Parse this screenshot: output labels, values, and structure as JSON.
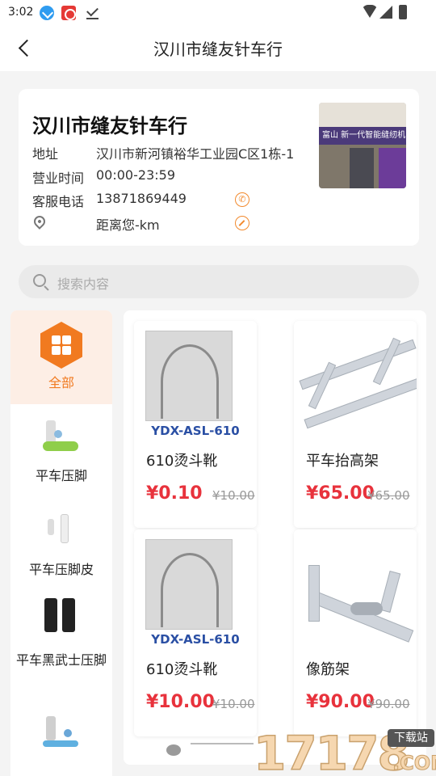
{
  "status_bar": {
    "time": "3:02"
  },
  "nav": {
    "title": "汉川市缝友针车行"
  },
  "shop": {
    "name": "汉川市缝友针车行",
    "address_label": "地址",
    "address": "汉川市新河镇裕华工业园C区1栋-1",
    "hours_label": "营业时间",
    "hours": "00:00-23:59",
    "phone_label": "客服电话",
    "phone": "13871869449",
    "distance": "距离您-km",
    "photo_sign": "富山 新一代智能缝纫机"
  },
  "search": {
    "placeholder": "搜索内容"
  },
  "categories": [
    {
      "label": "全部",
      "active": true
    },
    {
      "label": "平车压脚"
    },
    {
      "label": "平车压脚皮"
    },
    {
      "label": "平车黑武士压脚"
    },
    {
      "label": ""
    }
  ],
  "products": [
    {
      "name": "610烫斗靴",
      "price": "¥0.10",
      "original": "¥10.00",
      "image_caption": "YDX-ASL-610"
    },
    {
      "name": "平车抬高架",
      "price": "¥65.00",
      "original": "¥65.00"
    },
    {
      "name": "610烫斗靴",
      "price": "¥10.00",
      "original": "¥10.00",
      "image_caption": "YDX-ASL-610"
    },
    {
      "name": "像筋架",
      "price": "¥90.00",
      "original": "¥90.00"
    }
  ],
  "watermark": {
    "number": "17178",
    "tag": "下载站",
    "suffix": ".COM"
  },
  "colors": {
    "accent": "#f17a20",
    "price": "#e8323c",
    "active_bg": "#fdeee5"
  }
}
